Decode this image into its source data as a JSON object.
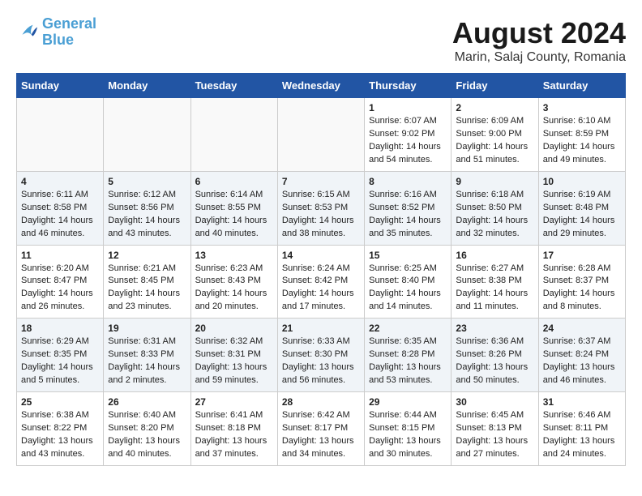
{
  "logo": {
    "line1": "General",
    "line2": "Blue"
  },
  "title": "August 2024",
  "subtitle": "Marin, Salaj County, Romania",
  "days_of_week": [
    "Sunday",
    "Monday",
    "Tuesday",
    "Wednesday",
    "Thursday",
    "Friday",
    "Saturday"
  ],
  "weeks": [
    {
      "row_class": "",
      "days": [
        {
          "number": "",
          "info": ""
        },
        {
          "number": "",
          "info": ""
        },
        {
          "number": "",
          "info": ""
        },
        {
          "number": "",
          "info": ""
        },
        {
          "number": "1",
          "info": "Sunrise: 6:07 AM\nSunset: 9:02 PM\nDaylight: 14 hours\nand 54 minutes."
        },
        {
          "number": "2",
          "info": "Sunrise: 6:09 AM\nSunset: 9:00 PM\nDaylight: 14 hours\nand 51 minutes."
        },
        {
          "number": "3",
          "info": "Sunrise: 6:10 AM\nSunset: 8:59 PM\nDaylight: 14 hours\nand 49 minutes."
        }
      ]
    },
    {
      "row_class": "alt-row",
      "days": [
        {
          "number": "4",
          "info": "Sunrise: 6:11 AM\nSunset: 8:58 PM\nDaylight: 14 hours\nand 46 minutes."
        },
        {
          "number": "5",
          "info": "Sunrise: 6:12 AM\nSunset: 8:56 PM\nDaylight: 14 hours\nand 43 minutes."
        },
        {
          "number": "6",
          "info": "Sunrise: 6:14 AM\nSunset: 8:55 PM\nDaylight: 14 hours\nand 40 minutes."
        },
        {
          "number": "7",
          "info": "Sunrise: 6:15 AM\nSunset: 8:53 PM\nDaylight: 14 hours\nand 38 minutes."
        },
        {
          "number": "8",
          "info": "Sunrise: 6:16 AM\nSunset: 8:52 PM\nDaylight: 14 hours\nand 35 minutes."
        },
        {
          "number": "9",
          "info": "Sunrise: 6:18 AM\nSunset: 8:50 PM\nDaylight: 14 hours\nand 32 minutes."
        },
        {
          "number": "10",
          "info": "Sunrise: 6:19 AM\nSunset: 8:48 PM\nDaylight: 14 hours\nand 29 minutes."
        }
      ]
    },
    {
      "row_class": "",
      "days": [
        {
          "number": "11",
          "info": "Sunrise: 6:20 AM\nSunset: 8:47 PM\nDaylight: 14 hours\nand 26 minutes."
        },
        {
          "number": "12",
          "info": "Sunrise: 6:21 AM\nSunset: 8:45 PM\nDaylight: 14 hours\nand 23 minutes."
        },
        {
          "number": "13",
          "info": "Sunrise: 6:23 AM\nSunset: 8:43 PM\nDaylight: 14 hours\nand 20 minutes."
        },
        {
          "number": "14",
          "info": "Sunrise: 6:24 AM\nSunset: 8:42 PM\nDaylight: 14 hours\nand 17 minutes."
        },
        {
          "number": "15",
          "info": "Sunrise: 6:25 AM\nSunset: 8:40 PM\nDaylight: 14 hours\nand 14 minutes."
        },
        {
          "number": "16",
          "info": "Sunrise: 6:27 AM\nSunset: 8:38 PM\nDaylight: 14 hours\nand 11 minutes."
        },
        {
          "number": "17",
          "info": "Sunrise: 6:28 AM\nSunset: 8:37 PM\nDaylight: 14 hours\nand 8 minutes."
        }
      ]
    },
    {
      "row_class": "alt-row",
      "days": [
        {
          "number": "18",
          "info": "Sunrise: 6:29 AM\nSunset: 8:35 PM\nDaylight: 14 hours\nand 5 minutes."
        },
        {
          "number": "19",
          "info": "Sunrise: 6:31 AM\nSunset: 8:33 PM\nDaylight: 14 hours\nand 2 minutes."
        },
        {
          "number": "20",
          "info": "Sunrise: 6:32 AM\nSunset: 8:31 PM\nDaylight: 13 hours\nand 59 minutes."
        },
        {
          "number": "21",
          "info": "Sunrise: 6:33 AM\nSunset: 8:30 PM\nDaylight: 13 hours\nand 56 minutes."
        },
        {
          "number": "22",
          "info": "Sunrise: 6:35 AM\nSunset: 8:28 PM\nDaylight: 13 hours\nand 53 minutes."
        },
        {
          "number": "23",
          "info": "Sunrise: 6:36 AM\nSunset: 8:26 PM\nDaylight: 13 hours\nand 50 minutes."
        },
        {
          "number": "24",
          "info": "Sunrise: 6:37 AM\nSunset: 8:24 PM\nDaylight: 13 hours\nand 46 minutes."
        }
      ]
    },
    {
      "row_class": "",
      "days": [
        {
          "number": "25",
          "info": "Sunrise: 6:38 AM\nSunset: 8:22 PM\nDaylight: 13 hours\nand 43 minutes."
        },
        {
          "number": "26",
          "info": "Sunrise: 6:40 AM\nSunset: 8:20 PM\nDaylight: 13 hours\nand 40 minutes."
        },
        {
          "number": "27",
          "info": "Sunrise: 6:41 AM\nSunset: 8:18 PM\nDaylight: 13 hours\nand 37 minutes."
        },
        {
          "number": "28",
          "info": "Sunrise: 6:42 AM\nSunset: 8:17 PM\nDaylight: 13 hours\nand 34 minutes."
        },
        {
          "number": "29",
          "info": "Sunrise: 6:44 AM\nSunset: 8:15 PM\nDaylight: 13 hours\nand 30 minutes."
        },
        {
          "number": "30",
          "info": "Sunrise: 6:45 AM\nSunset: 8:13 PM\nDaylight: 13 hours\nand 27 minutes."
        },
        {
          "number": "31",
          "info": "Sunrise: 6:46 AM\nSunset: 8:11 PM\nDaylight: 13 hours\nand 24 minutes."
        }
      ]
    }
  ]
}
